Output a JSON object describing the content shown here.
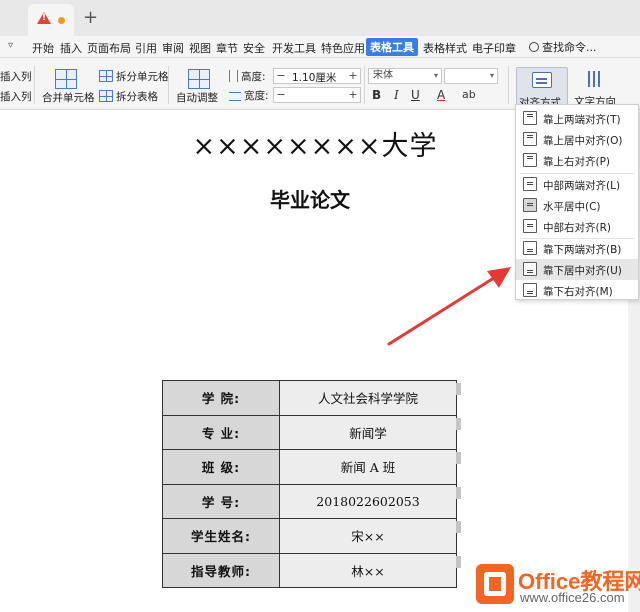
{
  "menubar": {
    "items": [
      "开始",
      "插入",
      "页面布局",
      "引用",
      "审阅",
      "视图",
      "章节",
      "安全",
      "开发工具",
      "特色应用",
      "表格工具",
      "表格样式",
      "电子印章"
    ],
    "active": "表格工具",
    "search_label": "查找命令..."
  },
  "ribbon": {
    "insert_col_1": "插入列",
    "insert_col_2": "插入列",
    "merge_cells": "合并单元格",
    "split_cells": "拆分单元格",
    "split_table": "拆分表格",
    "auto_adjust": "自动调整",
    "height_label": "高度:",
    "height_value": "1.10厘米",
    "width_label": "宽度:",
    "width_value": "",
    "font_name": "宋体",
    "font_size": "",
    "bold": "B",
    "italic": "I",
    "underline": "U",
    "font_color": "A",
    "highlight": "ab",
    "align_label": "对齐方式",
    "text_direction_label": "文字方向"
  },
  "document": {
    "title": "××××××××大学",
    "subtitle": "毕业论文",
    "rows": [
      {
        "key": "学    院:",
        "value": "人文社会科学学院"
      },
      {
        "key": "专    业:",
        "value": "新闻学"
      },
      {
        "key": "班    级:",
        "value": "新闻 A 班"
      },
      {
        "key": "学      号:",
        "value": "2018022602053"
      },
      {
        "key": "学生姓名:",
        "value": "宋××"
      },
      {
        "key": "指导教师:",
        "value": "林××"
      }
    ]
  },
  "align_menu": {
    "items": [
      "靠上两端对齐(T)",
      "靠上居中对齐(O)",
      "靠上右对齐(P)",
      "中部两端对齐(L)",
      "水平居中(C)",
      "中部右对齐(R)",
      "靠下两端对齐(B)",
      "靠下居中对齐(U)",
      "靠下右对齐(M)"
    ],
    "highlighted": "靠下居中对齐(U)",
    "selected": "水平居中(C)"
  },
  "watermark": {
    "brand": "Office教程网",
    "url": "www.office26.com"
  },
  "colors": {
    "accent": "#3a7fe0",
    "arrow": "#e53935",
    "brand_orange": "#f26522"
  }
}
